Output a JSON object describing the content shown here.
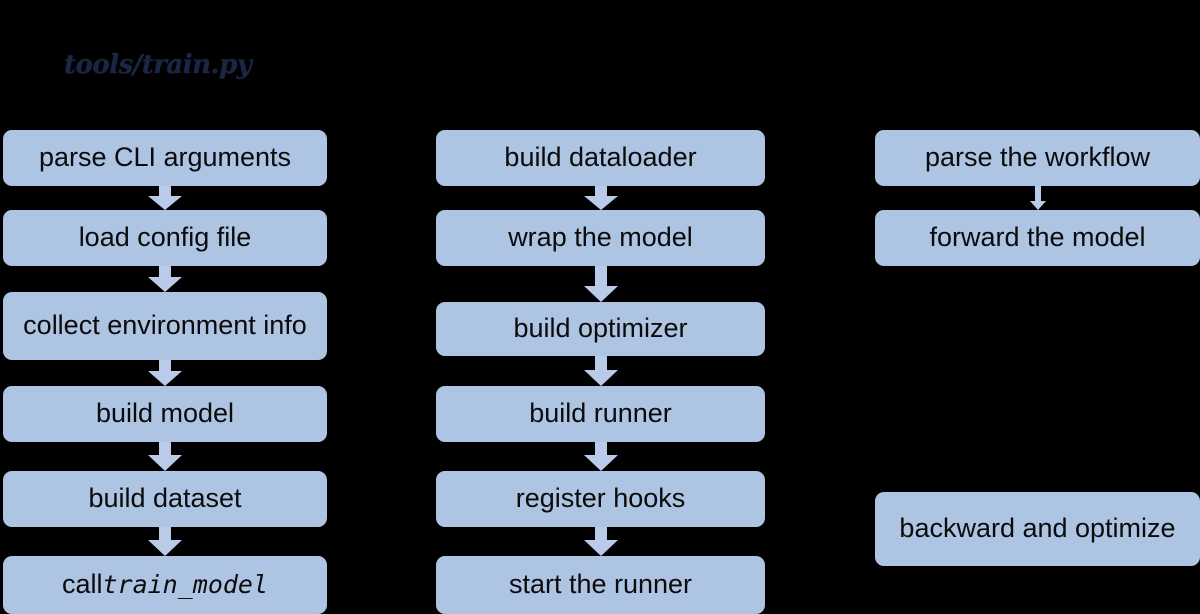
{
  "diagram": {
    "title": "tools/train.py",
    "background_color": "#000000",
    "node_color": "#aec4e3",
    "arrow_color": "#b9cbe9",
    "text_color": "#0b0b0b",
    "title_color": "#1b2642"
  },
  "columns": [
    {
      "id": "column-1",
      "nodes": [
        {
          "label": "parse CLI arguments"
        },
        {
          "label": "load config file"
        },
        {
          "label": "collect environment info"
        },
        {
          "label": "build model"
        },
        {
          "label": "build dataset"
        },
        {
          "label": "call train_model",
          "label_plain": "call ",
          "label_code": "train_model"
        }
      ],
      "arrows": [
        {
          "from": "parse CLI arguments",
          "to": "load config file",
          "style": "block"
        },
        {
          "from": "load config file",
          "to": "collect environment info",
          "style": "block"
        },
        {
          "from": "collect environment info",
          "to": "build model",
          "style": "block"
        },
        {
          "from": "build model",
          "to": "build dataset",
          "style": "block"
        },
        {
          "from": "build dataset",
          "to": "call train_model",
          "style": "block"
        }
      ]
    },
    {
      "id": "column-2",
      "nodes": [
        {
          "label": "build dataloader"
        },
        {
          "label": "wrap the model"
        },
        {
          "label": "build optimizer"
        },
        {
          "label": "build runner"
        },
        {
          "label": "register hooks"
        },
        {
          "label": "start the runner"
        }
      ],
      "arrows": [
        {
          "from": "build dataloader",
          "to": "wrap the model",
          "style": "block"
        },
        {
          "from": "wrap the model",
          "to": "build optimizer",
          "style": "block"
        },
        {
          "from": "build optimizer",
          "to": "build runner",
          "style": "block"
        },
        {
          "from": "build runner",
          "to": "register hooks",
          "style": "block"
        },
        {
          "from": "register hooks",
          "to": "start the runner",
          "style": "block"
        }
      ]
    },
    {
      "id": "column-3",
      "nodes": [
        {
          "label": "parse the workflow"
        },
        {
          "label": "forward the model"
        },
        {
          "label": "backward and optimize"
        }
      ],
      "arrows": [
        {
          "from": "parse the workflow",
          "to": "forward the model",
          "style": "thin"
        }
      ]
    }
  ]
}
